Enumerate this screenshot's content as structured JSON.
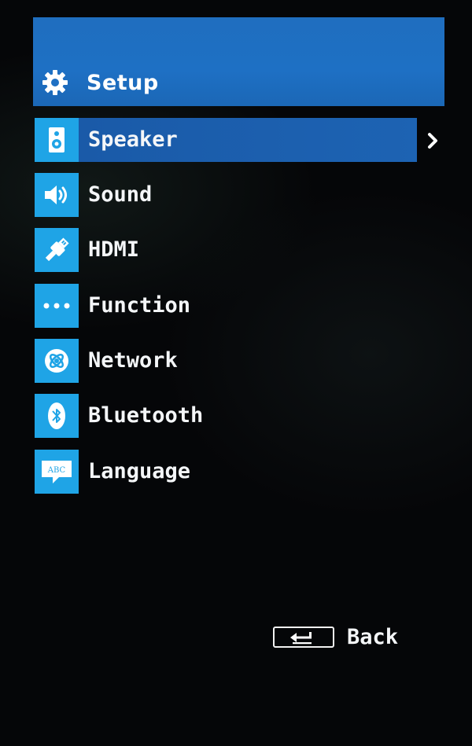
{
  "header": {
    "title": "Setup",
    "icon": "gear-icon",
    "color": "#1e70c4"
  },
  "menu": {
    "selected_index": 0,
    "items": [
      {
        "label": "Speaker",
        "icon": "speaker-icon"
      },
      {
        "label": "Sound",
        "icon": "volume-icon"
      },
      {
        "label": "HDMI",
        "icon": "hdmi-cable-icon"
      },
      {
        "label": "Function",
        "icon": "more-dots-icon"
      },
      {
        "label": "Network",
        "icon": "network-globe-icon"
      },
      {
        "label": "Bluetooth",
        "icon": "bluetooth-icon"
      },
      {
        "label": "Language",
        "icon": "abc-speech-icon"
      }
    ],
    "icon_color": "#1fa4e6",
    "highlight_color": "#1a5aa8"
  },
  "footer": {
    "back_label": "Back",
    "back_icon": "return-key-icon"
  }
}
